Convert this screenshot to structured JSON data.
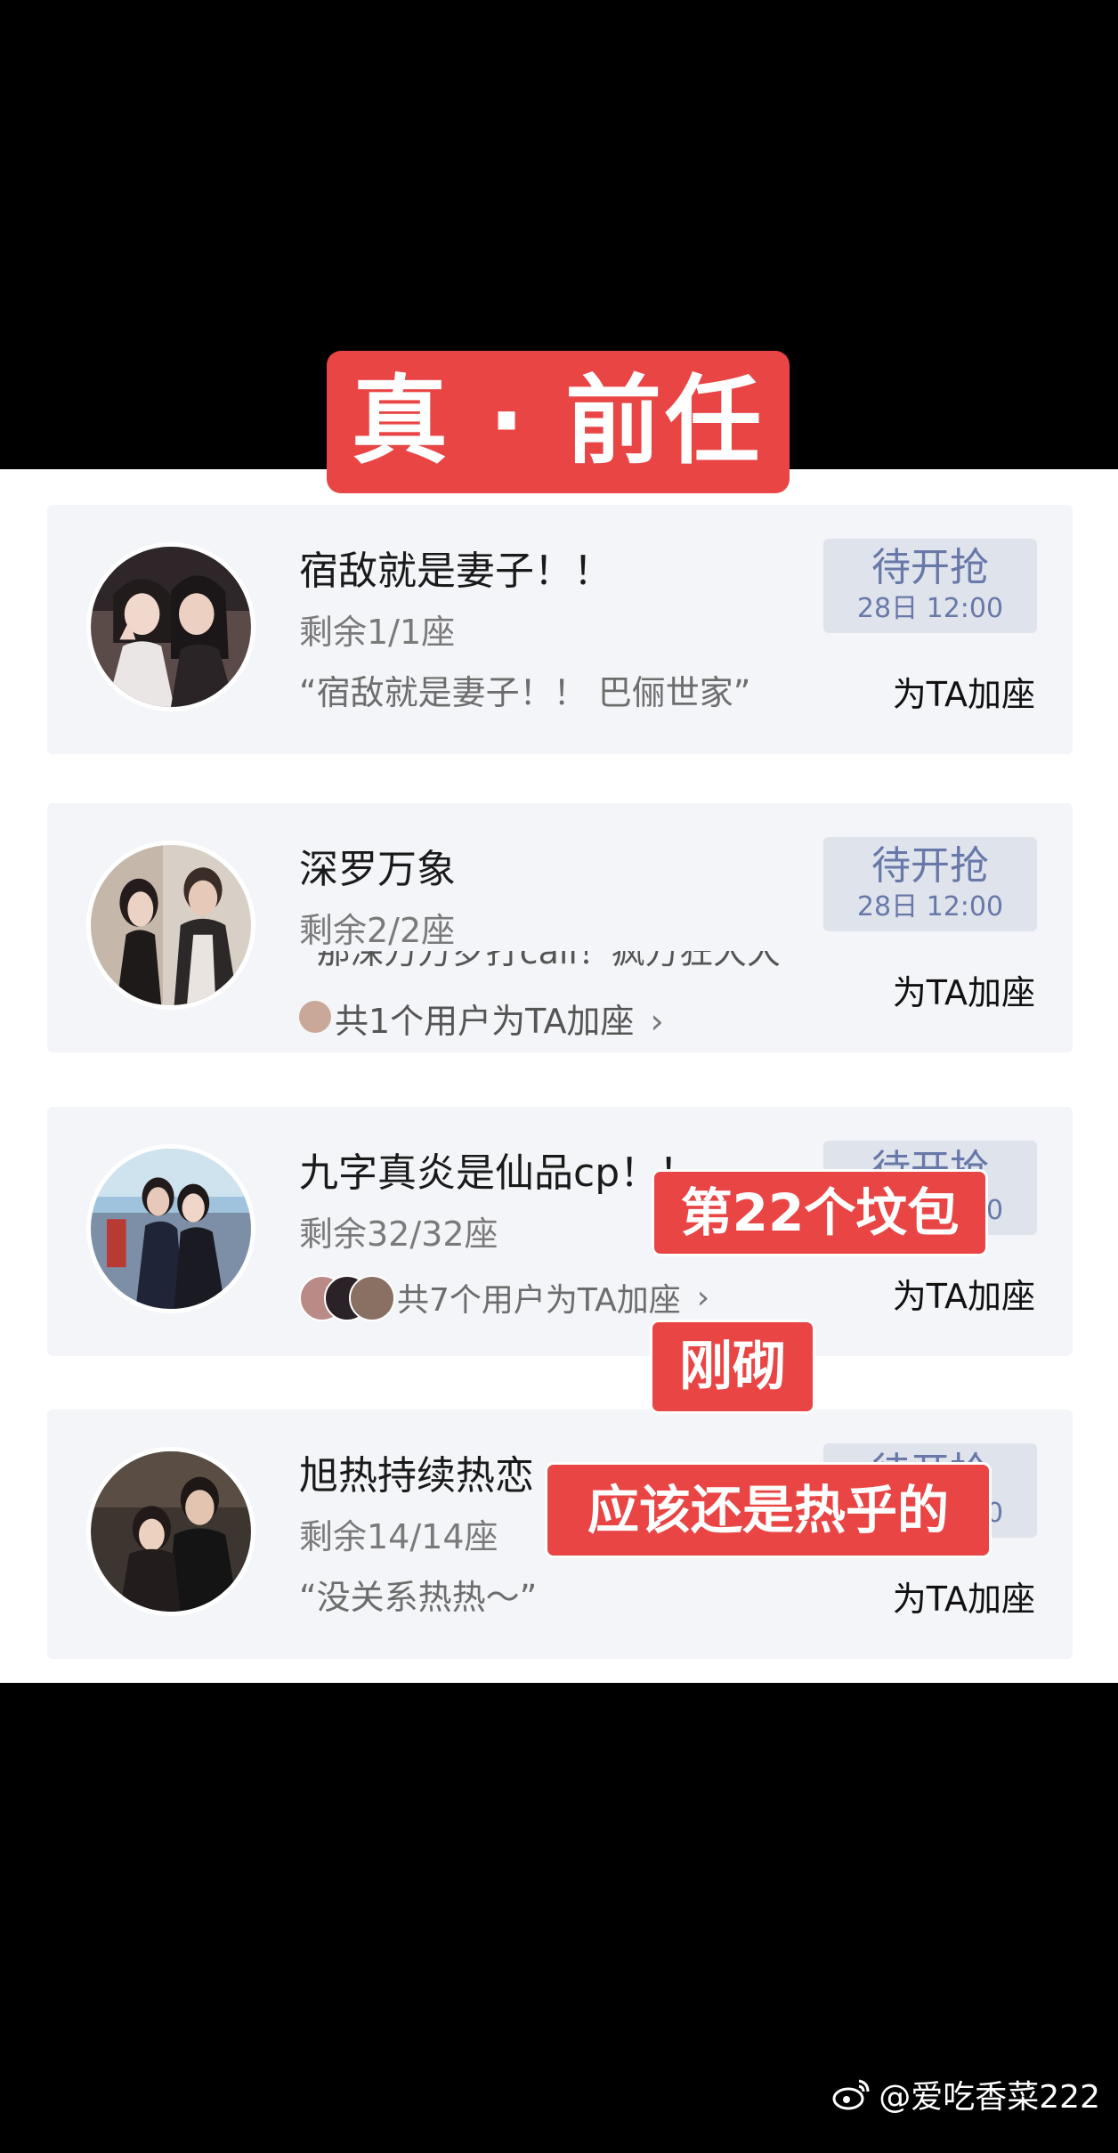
{
  "title_banner": "真 · 前任",
  "cards": [
    {
      "name": "宿敌就是妻子！！",
      "seats": "剩余1/1座",
      "quote": "“宿敌就是妻子！！ 巴俪世家”",
      "status": "待开抢",
      "status_time": "28日 12:00",
      "add_seat": "为TA加座"
    },
    {
      "name": "深罗万象",
      "seats": "剩余2/2座",
      "quote_partial": "“那深万万岁打call！疯万狂大大”",
      "supporters_text": "共1个用户为TA加座",
      "status": "待开抢",
      "status_time": "28日 12:00",
      "add_seat": "为TA加座"
    },
    {
      "name": "九字真炎是仙品cp！！",
      "seats": "剩余32/32座",
      "supporters_text": "共7个用户为TA加座",
      "status": "待开抢",
      "status_time": "28日 12:00",
      "add_seat": "为TA加座"
    },
    {
      "name": "旭热持续热恋",
      "seats": "剩余14/14座",
      "quote": "“没关系热热～”",
      "status": "待开抢",
      "status_time": "28日 12:00",
      "add_seat": "为TA加座"
    }
  ],
  "overlays": {
    "label_1": "第22个坟包",
    "label_2": "刚砌",
    "label_3": "应该还是热乎的"
  },
  "watermark": "@爱吃香菜222",
  "colors": {
    "banner_red": "#e94545",
    "card_bg": "#f4f5f8",
    "status_bg": "#dfe3ec",
    "status_text": "#6878a8"
  }
}
